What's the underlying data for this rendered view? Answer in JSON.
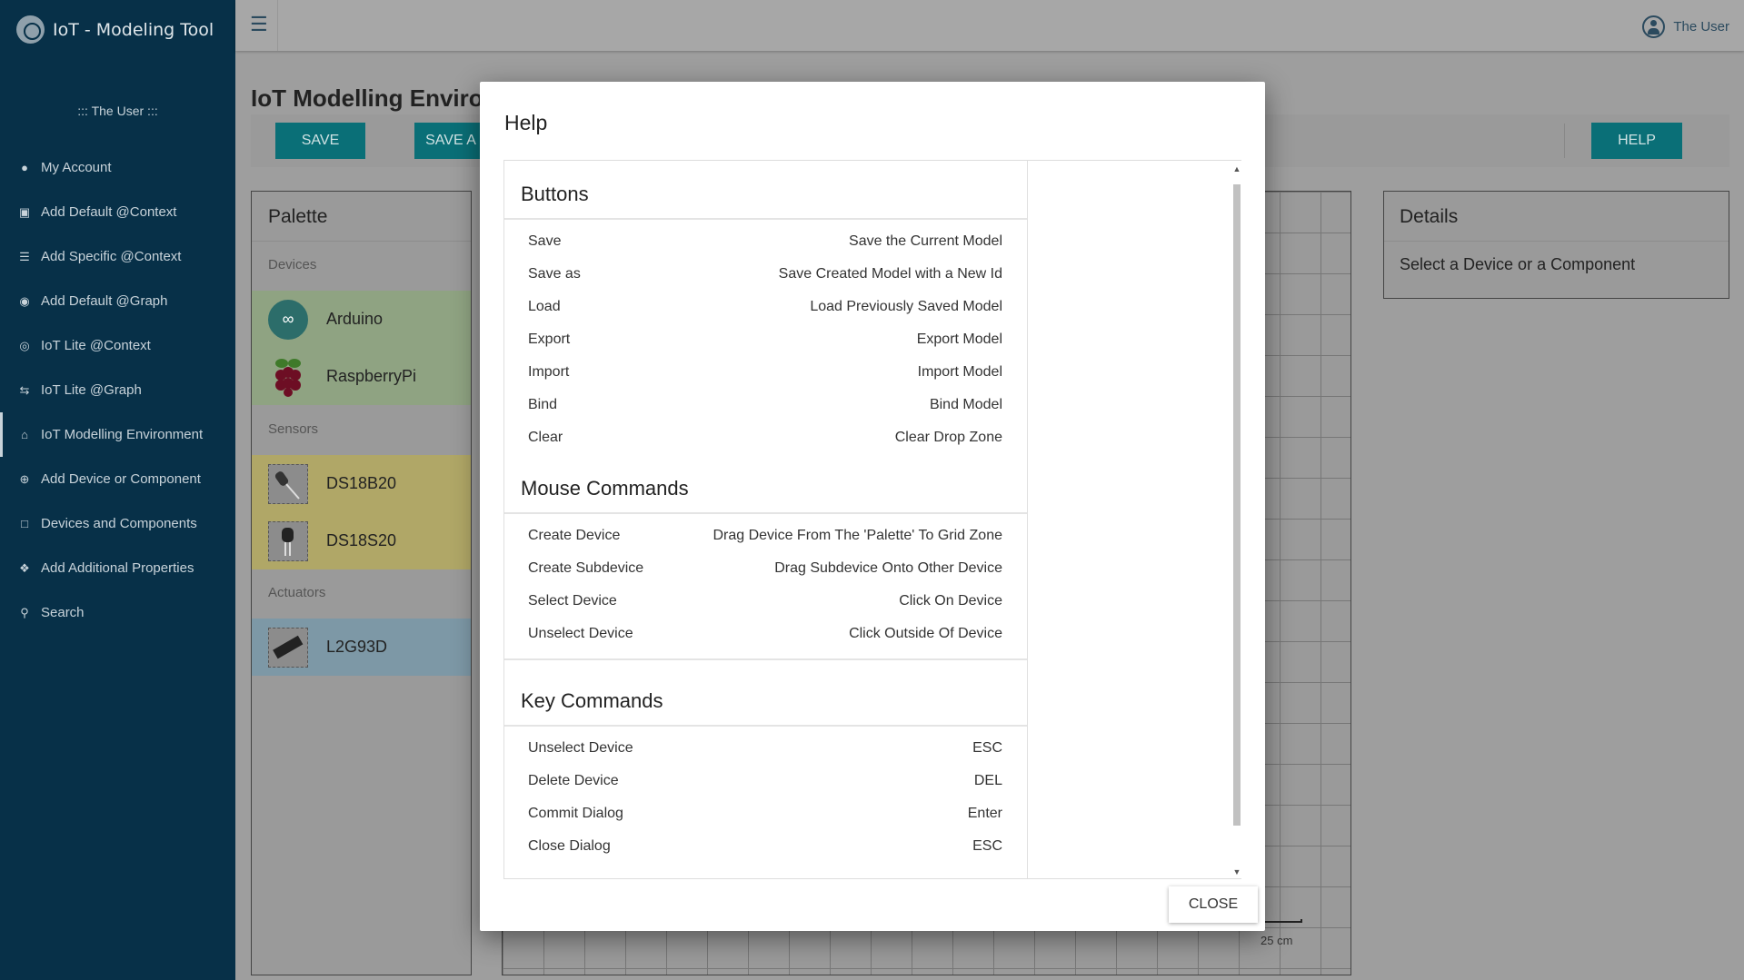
{
  "app": {
    "title": "IoT - Modeling Tool"
  },
  "sidebar": {
    "user": "::: The User :::",
    "items": [
      {
        "label": "My Account",
        "icon": "user-icon"
      },
      {
        "label": "Add Default @Context",
        "icon": "cubes-icon"
      },
      {
        "label": "Add Specific @Context",
        "icon": "database-icon"
      },
      {
        "label": "Add Default @Graph",
        "icon": "compass-icon"
      },
      {
        "label": "IoT Lite @Context",
        "icon": "bullseye-icon"
      },
      {
        "label": "IoT Lite @Graph",
        "icon": "exchange-icon"
      },
      {
        "label": "IoT Modelling Environment",
        "icon": "home-icon"
      },
      {
        "label": "Add Device or Component",
        "icon": "plus-circle-icon"
      },
      {
        "label": "Devices and Components",
        "icon": "square-icon"
      },
      {
        "label": "Add Additional Properties",
        "icon": "puzzle-icon"
      },
      {
        "label": "Search",
        "icon": "search-icon"
      }
    ]
  },
  "topbar": {
    "user": "The User"
  },
  "page": {
    "title": "IoT Modelling Environ",
    "toolbar": {
      "save": "SAVE",
      "save_as": "SAVE A",
      "help": "HELP"
    }
  },
  "palette": {
    "title": "Palette",
    "categories": {
      "devices": "Devices",
      "sensors": "Sensors",
      "actuators": "Actuators"
    },
    "devices": [
      "Arduino",
      "RaspberryPi"
    ],
    "sensors": [
      "DS18B20",
      "DS18S20"
    ],
    "actuators": [
      "L2G93D"
    ]
  },
  "grid": {
    "scale_label": "25 cm"
  },
  "details": {
    "title": "Details",
    "text": "Select a Device or a Component"
  },
  "dialog": {
    "title": "Help",
    "close": "CLOSE",
    "sections": {
      "buttons": {
        "title": "Buttons",
        "rows": [
          [
            "Save",
            "Save the Current Model"
          ],
          [
            "Save as",
            "Save Created Model with a New Id"
          ],
          [
            "Load",
            "Load Previously Saved Model"
          ],
          [
            "Export",
            "Export Model"
          ],
          [
            "Import",
            "Import Model"
          ],
          [
            "Bind",
            "Bind Model"
          ],
          [
            "Clear",
            "Clear Drop Zone"
          ]
        ]
      },
      "mouse": {
        "title": "Mouse Commands",
        "rows": [
          [
            "Create Device",
            "Drag Device From The 'Palette' To Grid Zone"
          ],
          [
            "Create Subdevice",
            "Drag Subdevice Onto Other Device"
          ],
          [
            "Select Device",
            "Click On Device"
          ],
          [
            "Unselect Device",
            "Click Outside Of Device"
          ]
        ]
      },
      "keys": {
        "title": "Key Commands",
        "rows": [
          [
            "Unselect Device",
            "ESC"
          ],
          [
            "Delete Device",
            "DEL"
          ],
          [
            "Commit Dialog",
            "Enter"
          ],
          [
            "Close Dialog",
            "ESC"
          ]
        ]
      }
    }
  },
  "colors": {
    "sidebar": "#073048",
    "accent": "#0a6f77",
    "devices_bg": "#8fa382",
    "sensors_bg": "#b0a767",
    "actuators_bg": "#7d98a6"
  }
}
